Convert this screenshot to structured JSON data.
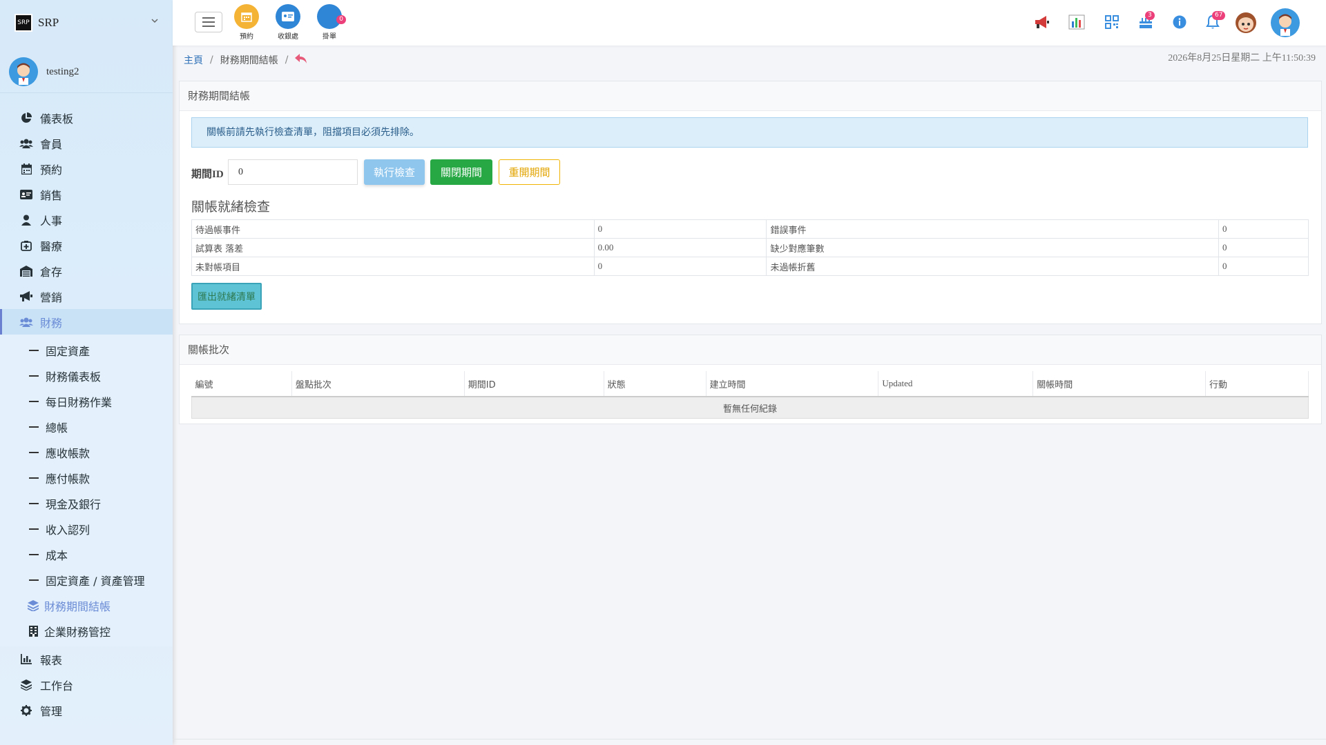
{
  "brand": {
    "name": "SRP",
    "logo_text": "SRP"
  },
  "user": {
    "name": "testing2"
  },
  "nav": {
    "items": [
      {
        "label": "儀表板"
      },
      {
        "label": "會員"
      },
      {
        "label": "預約"
      },
      {
        "label": "銷售"
      },
      {
        "label": "人事"
      },
      {
        "label": "醫療"
      },
      {
        "label": "倉存"
      },
      {
        "label": "營銷"
      },
      {
        "label": "財務"
      }
    ],
    "finance_sub": [
      {
        "label": "固定資產"
      },
      {
        "label": "財務儀表板"
      },
      {
        "label": "每日財務作業"
      },
      {
        "label": "總帳"
      },
      {
        "label": "應收帳款"
      },
      {
        "label": "應付帳款"
      },
      {
        "label": "現金及銀行"
      },
      {
        "label": "收入認列"
      },
      {
        "label": "成本"
      },
      {
        "label": "固定資產 / 資產管理"
      },
      {
        "label": "財務期間結帳"
      },
      {
        "label": "企業財務管控"
      }
    ],
    "bottom_items": [
      {
        "label": "報表"
      },
      {
        "label": "工作台"
      },
      {
        "label": "管理"
      }
    ]
  },
  "topbar": {
    "quick": [
      {
        "label": "預約",
        "color": "#f5b335"
      },
      {
        "label": "收銀處",
        "color": "#2f86d6"
      },
      {
        "label": "掛單",
        "color": "#2f86d6",
        "badge": "0"
      }
    ],
    "badges": {
      "cake": "3",
      "bell": "67"
    }
  },
  "breadcrumb": {
    "home": "主頁",
    "current": "財務期間結帳",
    "separator": "/"
  },
  "datetime": "2026年8月25日星期二 上午11:50:39",
  "card1": {
    "title": "財務期間結帳",
    "alert": "關帳前請先執行檢查清單，阻擋項目必須先排除。",
    "period_label": "期間ID",
    "period_value": "0",
    "btn_check": "執行檢查",
    "btn_close": "關閉期間",
    "btn_reopen": "重開期間",
    "section_title": "關帳就緒檢查",
    "rows": [
      {
        "k1": "待過帳事件",
        "v1": "0",
        "k2": "錯誤事件",
        "v2": "0"
      },
      {
        "k1": "試算表 落差",
        "v1": "0.00",
        "k2": "缺少對應筆數",
        "v2": "0"
      },
      {
        "k1": "未對帳項目",
        "v1": "0",
        "k2": "未過帳折舊",
        "v2": "0"
      }
    ],
    "btn_export": "匯出就緒清單"
  },
  "card2": {
    "title": "關帳批次",
    "columns": [
      "編號",
      "盤點批次",
      "期間ID",
      "狀態",
      "建立時間",
      "Updated",
      "關帳時間",
      "行動"
    ],
    "empty": "暫無任何紀錄"
  }
}
